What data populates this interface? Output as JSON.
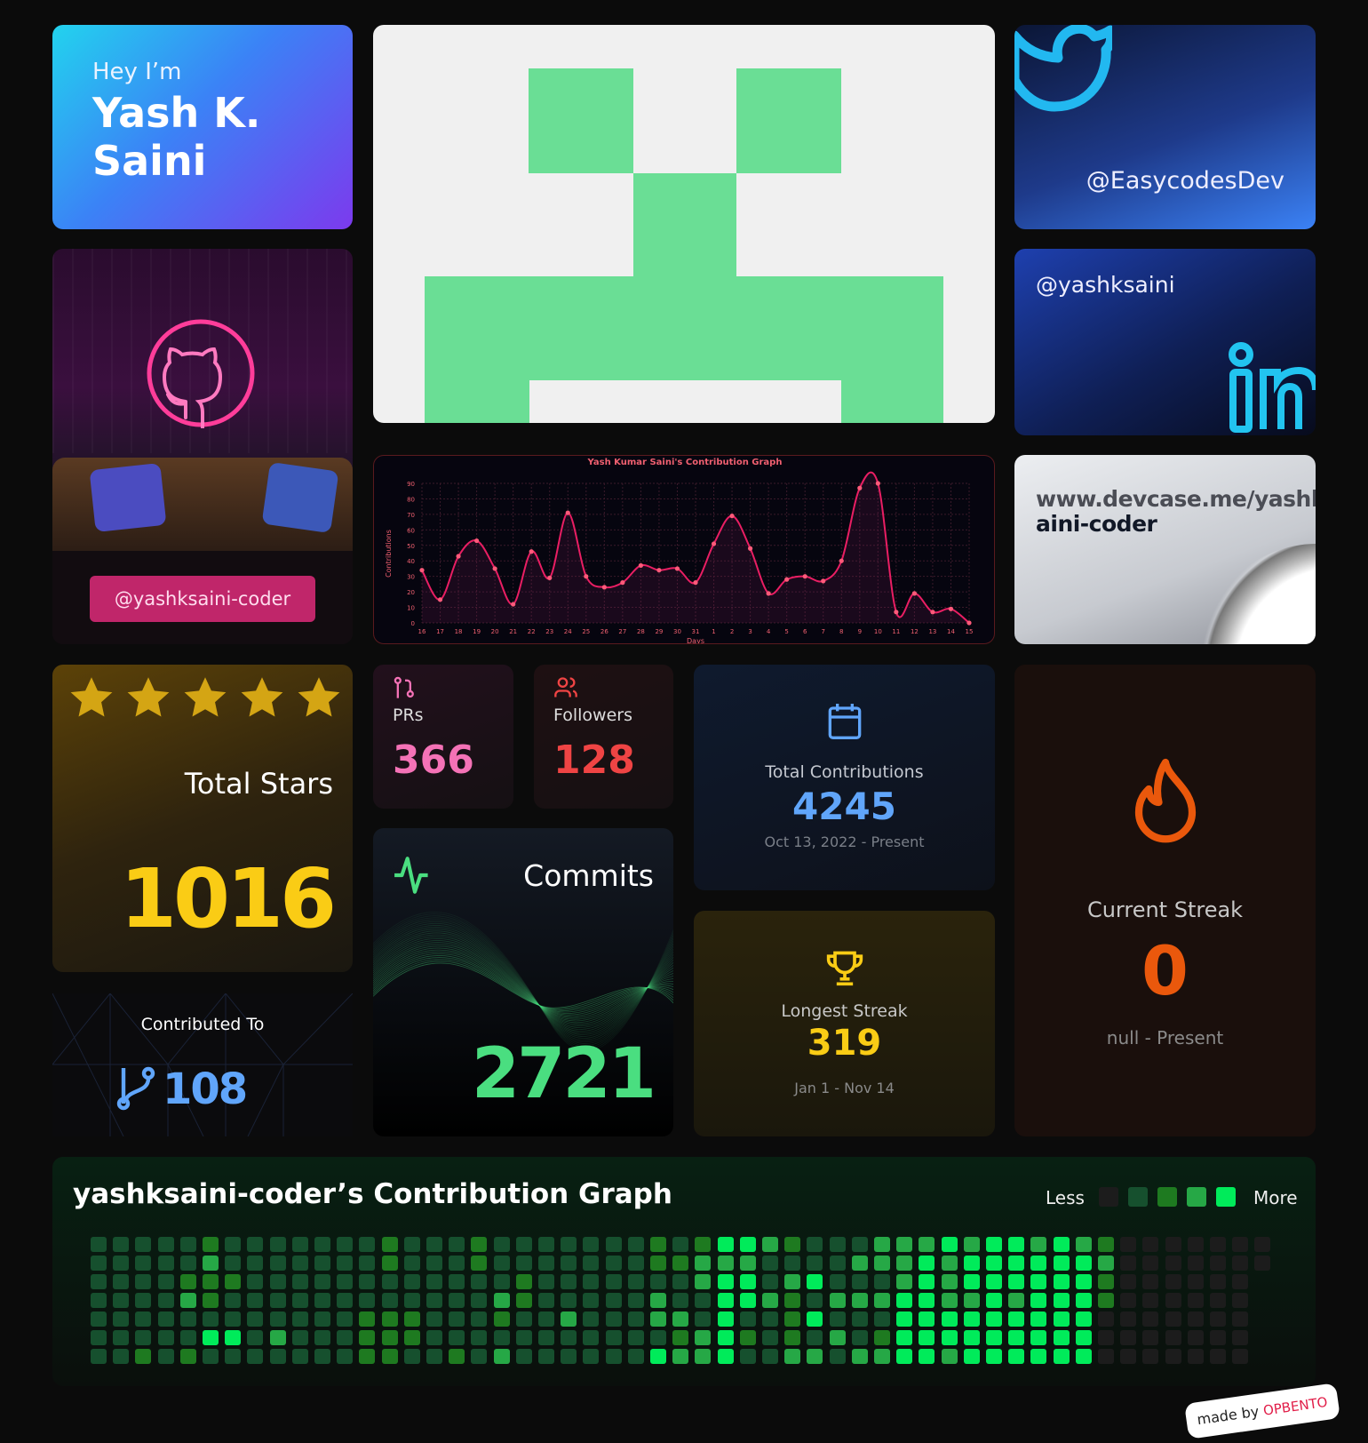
{
  "intro": {
    "greeting": "Hey I’m",
    "name": "Yash K. Saini"
  },
  "twitter": {
    "handle": "@EasycodesDev",
    "icon": "twitter-bird-icon"
  },
  "github": {
    "handle": "@yashksaini-coder",
    "icon": "github-icon"
  },
  "linkedin": {
    "handle": "@yashksaini",
    "icon": "linkedin-icon"
  },
  "devcase": {
    "url_part1": "www.devcase.me/yashks",
    "url_part2": "aini-coder"
  },
  "stars": {
    "label": "Total Stars",
    "value": "1016",
    "rating": 5,
    "icon": "star-icon"
  },
  "prs": {
    "label": "PRs",
    "value": "366",
    "icon": "git-pull-request-icon",
    "color": "#f472b6"
  },
  "followers": {
    "label": "Followers",
    "value": "128",
    "icon": "users-icon",
    "color": "#ef4444"
  },
  "commits": {
    "label": "Commits",
    "value": "2721",
    "icon": "activity-icon"
  },
  "total_contributions": {
    "label": "Total Contributions",
    "value": "4245",
    "range": "Oct 13, 2022 - Present",
    "icon": "calendar-icon"
  },
  "longest_streak": {
    "label": "Longest Streak",
    "value": "319",
    "range": "Jan 1 - Nov 14",
    "icon": "trophy-icon"
  },
  "current_streak": {
    "label": "Current Streak",
    "value": "0",
    "range": "null - Present",
    "icon": "flame-icon"
  },
  "contributed_to": {
    "label": "Contributed To",
    "value": "108",
    "icon": "git-fork-icon"
  },
  "heatmap": {
    "title": "yashksaini-coder’s Contribution Graph",
    "less": "Less",
    "more": "More",
    "level_colors": [
      "#1c1c1c",
      "#16502e",
      "#1e7a20",
      "#26a846",
      "#00eb5a"
    ],
    "columns": [
      "1111111",
      "1111111",
      "1111112",
      "1111111",
      "1123112",
      "2322141",
      "1121141",
      "1111111",
      "1111131",
      "1111111",
      "1111111",
      "1111111",
      "1111222",
      "2211222",
      "1111221",
      "1111111",
      "1111112",
      "2211111",
      "1113213",
      "1122111",
      "1111111",
      "1111311",
      "1111111",
      "1111111",
      "1111111",
      "2213314",
      "1211323",
      "2331133",
      "4344444",
      "4344121",
      "3113111",
      "2132223",
      "1141413",
      "1113131",
      "1313113",
      "3313123",
      "3334444",
      "3444444",
      "4333443",
      "3443444",
      "4444444",
      "4443444",
      "3444444",
      "4444444",
      "3444444",
      "2322000",
      "0000000",
      "0000000",
      "0000000",
      "0000000",
      "0000000",
      "0000000",
      "00"
    ]
  },
  "footer": {
    "made_by": "made by",
    "brand": "OPBENTO"
  },
  "chart_data": {
    "type": "line",
    "title": "Yash Kumar Saini's Contribution Graph",
    "xlabel": "Days",
    "ylabel": "Contributions",
    "categories": [
      "16",
      "17",
      "18",
      "19",
      "20",
      "21",
      "22",
      "23",
      "24",
      "25",
      "26",
      "27",
      "28",
      "29",
      "30",
      "31",
      "1",
      "2",
      "3",
      "4",
      "5",
      "6",
      "7",
      "8",
      "9",
      "10",
      "11",
      "12",
      "13",
      "14",
      "15"
    ],
    "values": [
      34,
      15,
      43,
      53,
      35,
      12,
      46,
      29,
      71,
      30,
      23,
      26,
      37,
      34,
      35,
      26,
      51,
      69,
      48,
      19,
      28,
      30,
      27,
      40,
      87,
      90,
      7,
      19,
      7,
      9,
      0
    ],
    "yticks": [
      0,
      10,
      20,
      30,
      40,
      50,
      60,
      70,
      80,
      90
    ],
    "ylim": [
      0,
      90
    ],
    "grid": true,
    "color": "#e91e63"
  }
}
